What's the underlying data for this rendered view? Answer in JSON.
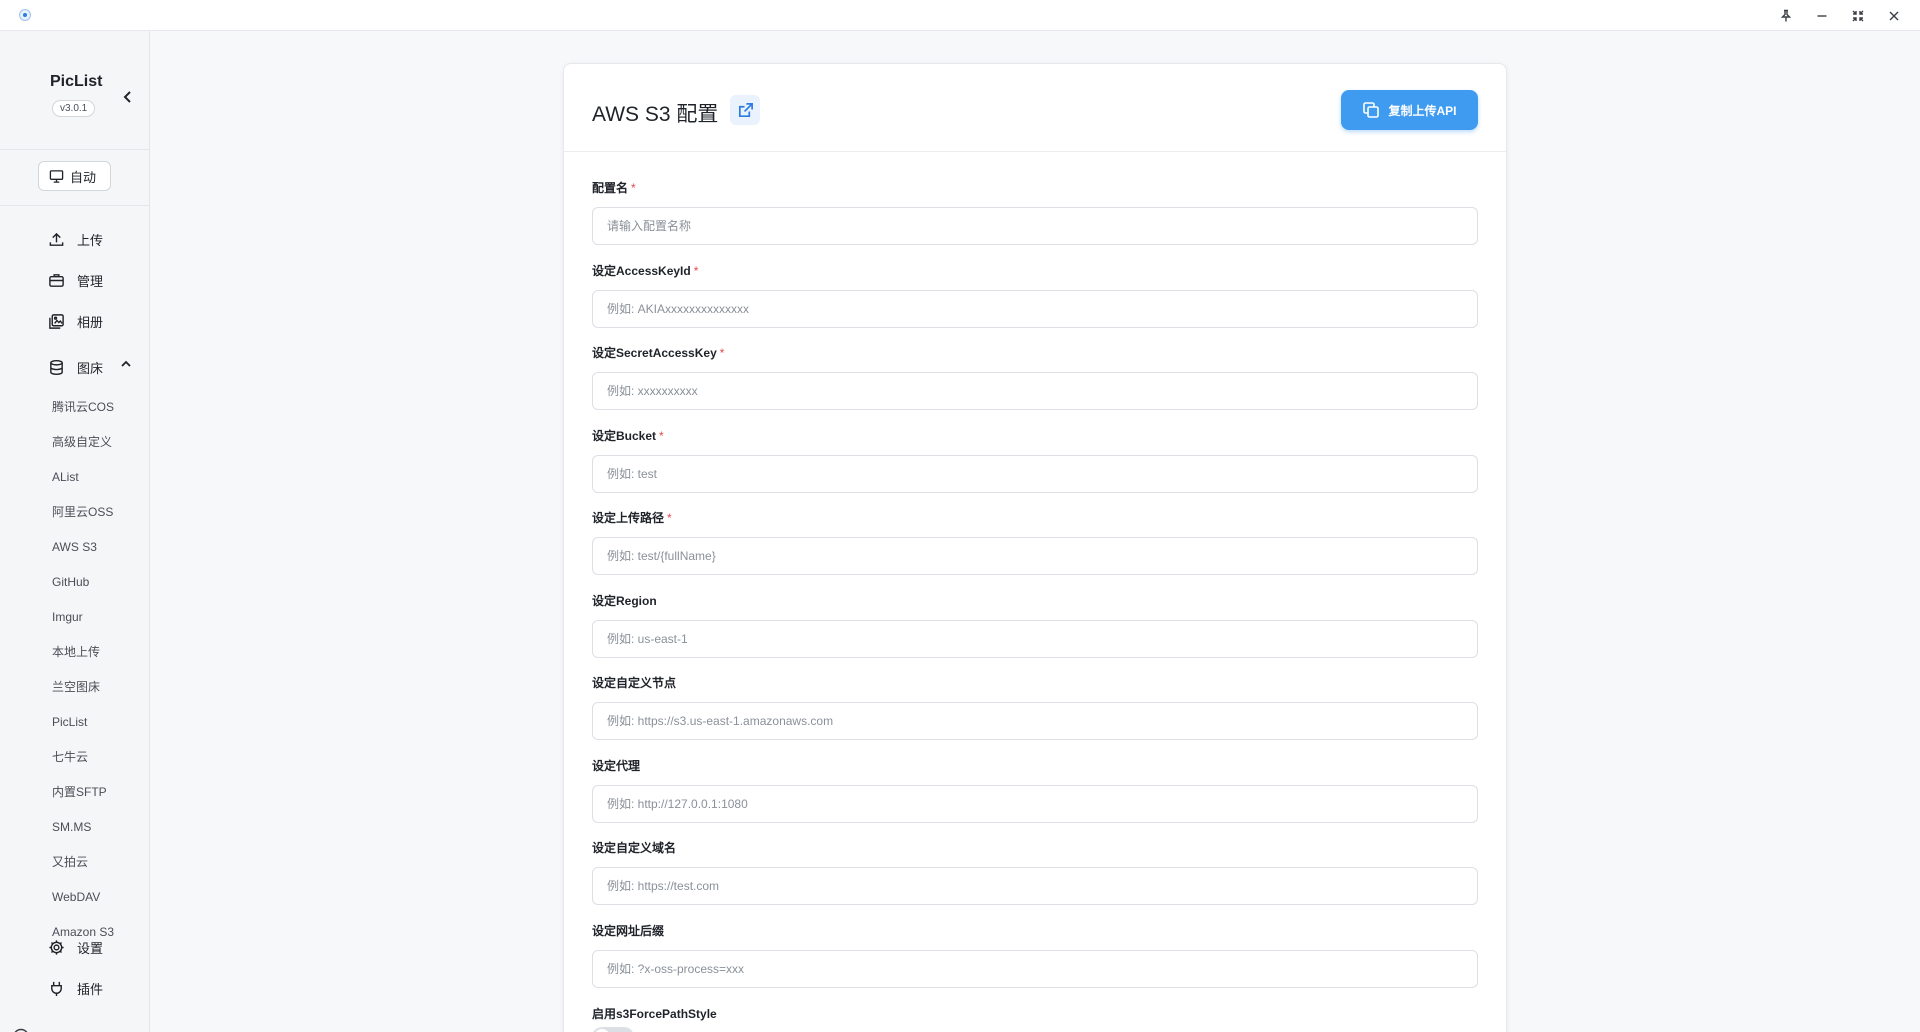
{
  "app": {
    "name": "PicList",
    "version": "v3.0.1"
  },
  "theme_button": {
    "label": "自动",
    "icon": "monitor-icon"
  },
  "nav": {
    "upload": "上传",
    "manage": "管理",
    "gallery": "相册",
    "picbed": "图床",
    "settings": "设置",
    "plugins": "插件"
  },
  "picbeds": [
    "腾讯云COS",
    "高级自定义",
    "AList",
    "阿里云OSS",
    "AWS S3",
    "GitHub",
    "Imgur",
    "本地上传",
    "兰空图床",
    "PicList",
    "七牛云",
    "内置SFTP",
    "SM.MS",
    "又拍云",
    "WebDAV",
    "Amazon S3"
  ],
  "page": {
    "title": "AWS S3 配置",
    "copy_api_label": "复制上传API"
  },
  "form": {
    "config_name": {
      "label": "配置名",
      "placeholder": "请输入配置名称"
    },
    "access_key_id": {
      "label": "设定AccessKeyId",
      "placeholder": "例如: AKIAxxxxxxxxxxxxxx"
    },
    "secret_access_key": {
      "label": "设定SecretAccessKey",
      "placeholder": "例如: xxxxxxxxxx"
    },
    "bucket": {
      "label": "设定Bucket",
      "placeholder": "例如: test"
    },
    "upload_path": {
      "label": "设定上传路径",
      "placeholder": "例如: test/{fullName}"
    },
    "region": {
      "label": "设定Region",
      "placeholder": "例如: us-east-1"
    },
    "endpoint": {
      "label": "设定自定义节点",
      "placeholder": "例如: https://s3.us-east-1.amazonaws.com"
    },
    "proxy": {
      "label": "设定代理",
      "placeholder": "例如: http://127.0.0.1:1080"
    },
    "custom_domain": {
      "label": "设定自定义域名",
      "placeholder": "例如: https://test.com"
    },
    "url_suffix": {
      "label": "设定网址后缀",
      "placeholder": "例如: ?x-oss-process=xxx"
    },
    "force_path_style": {
      "label": "启用s3ForcePathStyle",
      "enabled": false
    }
  },
  "required_mark": "*",
  "colors": {
    "accent": "#3e9bf0",
    "required": "#e5484d"
  }
}
